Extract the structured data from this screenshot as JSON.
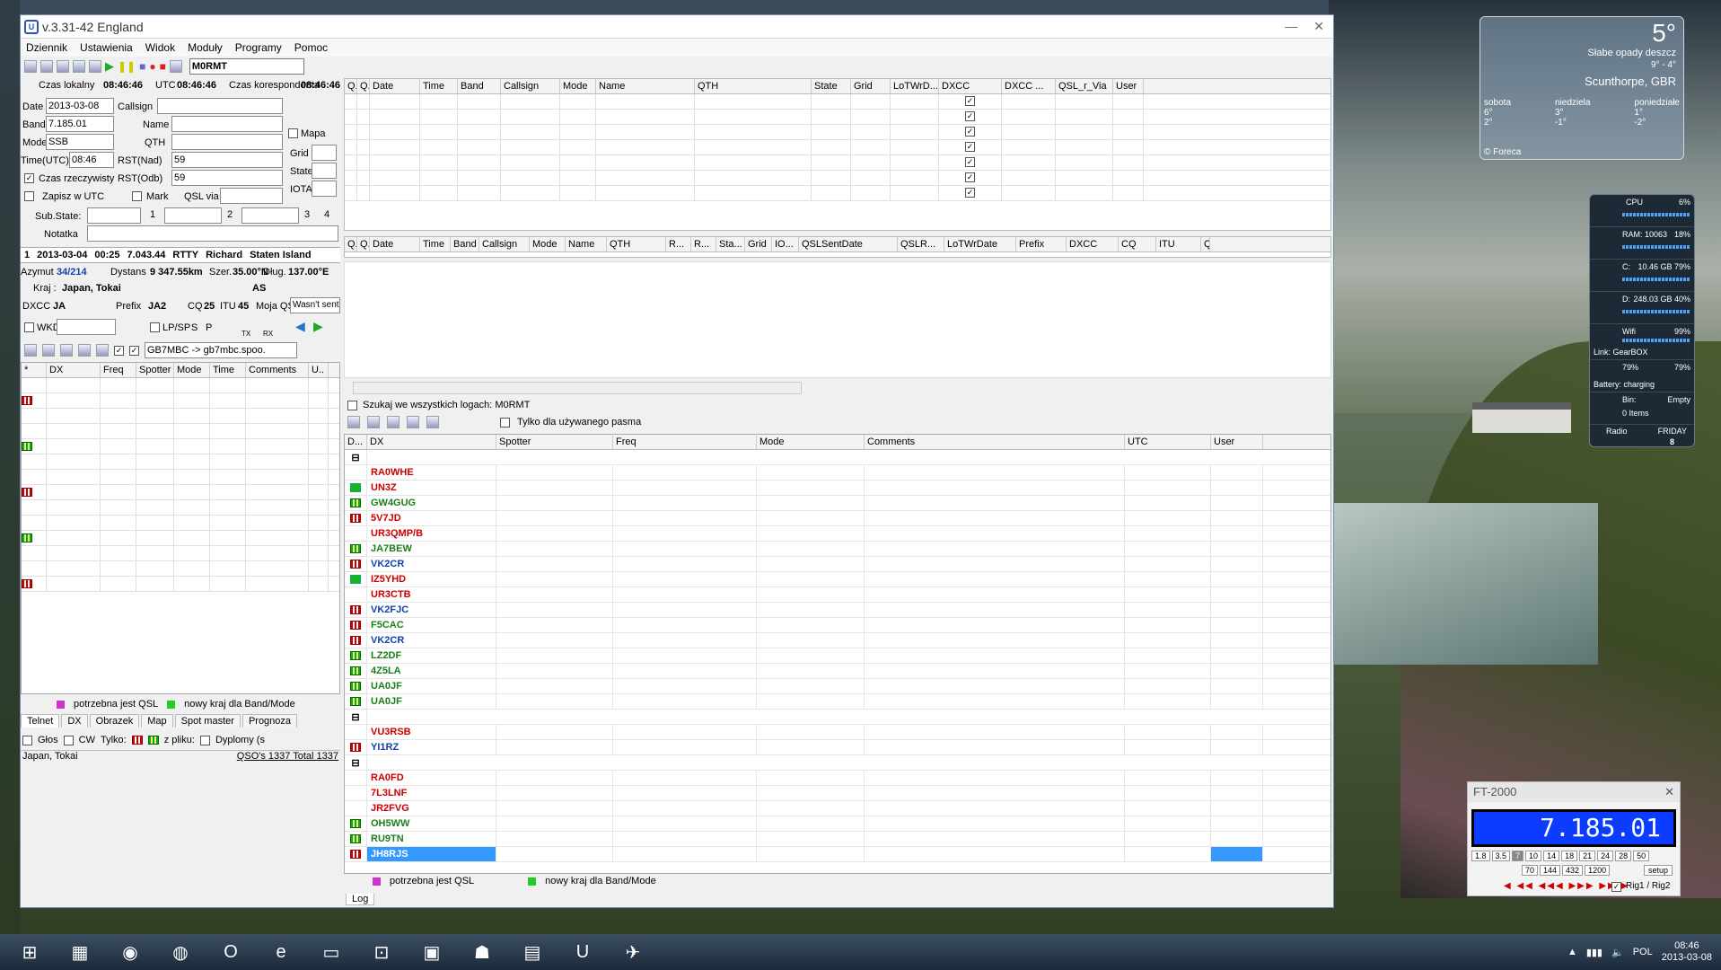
{
  "app": {
    "title": "v.3.31-42 England",
    "icon": "U"
  },
  "menu": [
    "Dziennik",
    "Ustawienia",
    "Widok",
    "Moduły",
    "Programy",
    "Pomoc"
  ],
  "toolbar": {
    "callsign": "M0RMT"
  },
  "clock": {
    "local_label": "Czas lokalny",
    "local": "08:46:46",
    "utc_label": "UTC",
    "utc": "08:46:46",
    "corr_label": "Czas korespondenta",
    "corr": "08:46:46"
  },
  "qso": {
    "date_label": "Date",
    "date": "2013-03-08",
    "band_label": "Band",
    "band": "7.185.01",
    "mode_label": "Mode",
    "mode": "SSB",
    "time_label": "Time(UTC)",
    "time": "08:46",
    "callsign_label": "Callsign",
    "name_label": "Name",
    "qth_label": "QTH",
    "rst_s_label": "RST(Nad)",
    "rst_s": "59",
    "rst_r_label": "RST(Odb)",
    "rst_r": "59",
    "realtime_label": "Czas rzeczywisty",
    "save_utc_label": "Zapisz w UTC",
    "mark_label": "Mark",
    "qslvia_label": "QSL via",
    "map_label": "Mapa",
    "grid_label": "Grid",
    "state_label": "State",
    "iota_label": "IOTA",
    "substate_label": "Sub.State:",
    "note_label": "Notatka",
    "n1": "1",
    "n2": "2",
    "n3": "3",
    "n4": "4",
    "m": "M"
  },
  "lastqso": {
    "num": "1",
    "date": "2013-03-04",
    "time": "00:25",
    "freq": "7.043.44",
    "mode": "RTTY",
    "name": "Richard",
    "qth": "Staten Island"
  },
  "info": {
    "azimuth_label": "Azymut",
    "azimuth": "34/214",
    "distance_label": "Dystans",
    "distance": "9 347.55km",
    "lat_label": "Szer.",
    "lat": "35.00°N",
    "lon_label": "Dług.",
    "lon": "137.00°E",
    "country_label": "Kraj :",
    "country": "Japan, Tokai",
    "continent": "AS",
    "dxcc_label": "DXCC",
    "dxcc": "JA",
    "prefix_label": "Prefix",
    "prefix": "JA2",
    "cq_label": "CQ",
    "cq": "25",
    "itu_label": "ITU",
    "itu": "45",
    "myqsl_label": "Moja QSL",
    "myqsl": "Wasn't sent"
  },
  "wkd": {
    "wkd_label": "WKD",
    "lpsp_label": "LP/SP",
    "s": "S",
    "p": "P",
    "tx": "TX",
    "rx": "RX"
  },
  "cluster": {
    "server": "GB7MBC -> gb7mbc.spoo.",
    "columns": [
      "*",
      "DX",
      "Freq",
      "Spotter",
      "Mode",
      "Time",
      "Comments",
      "U.."
    ]
  },
  "legend": {
    "need_qsl": "potrzebna jest QSL",
    "new_country": "nowy kraj dla Band/Mode"
  },
  "left_tabs": [
    "Telnet",
    "DX",
    "Obrazek",
    "Map",
    "Spot master",
    "Prognoza"
  ],
  "filters": {
    "glos": "Głos",
    "cw": "CW",
    "only": "Tylko:",
    "fromfile": "z pliku:",
    "diplomas": "Dyplomy (s"
  },
  "status": {
    "location": "Japan, Tokai",
    "total": "QSO's 1337 Total 1337"
  },
  "log_top": {
    "columns": [
      "Q.",
      "Q.",
      "Date",
      "Time",
      "Band",
      "Callsign",
      "Mode",
      "Name",
      "QTH",
      "State",
      "Grid",
      "LoTWrD...",
      "DXCC",
      "DXCC ...",
      "QSL_r_Via",
      "User"
    ]
  },
  "log_bottom": {
    "columns": [
      "Q.",
      "Q.",
      "Date",
      "Time",
      "Band",
      "Callsign",
      "Mode",
      "Name",
      "QTH",
      "R...",
      "R...",
      "Sta...",
      "Grid",
      "IO...",
      "QSLSentDate",
      "QSLR...",
      "LoTWrDate",
      "Prefix",
      "DXCC",
      "CQ",
      "ITU",
      "Q"
    ]
  },
  "search": {
    "all_logs": "Szukaj we wszystkich logach: M0RMT",
    "band_only": "Tylko dla używanego pasma"
  },
  "dxgrid": {
    "columns": [
      "D...",
      "DX",
      "Spotter",
      "Freq",
      "Mode",
      "Comments",
      "UTC",
      "User"
    ],
    "group1": [
      {
        "call": "RA0WHE",
        "c": "red",
        "f": ""
      },
      {
        "call": "UN3Z",
        "c": "red",
        "f": "g"
      },
      {
        "call": "GW4GUG",
        "c": "green",
        "f": "gc"
      },
      {
        "call": "5V7JD",
        "c": "red",
        "f": "r"
      },
      {
        "call": "UR3QMP/B",
        "c": "red",
        "f": ""
      },
      {
        "call": "JA7BEW",
        "c": "green",
        "f": "gc"
      },
      {
        "call": "VK2CR",
        "c": "blue",
        "f": "r"
      },
      {
        "call": "IZ5YHD",
        "c": "red",
        "f": "g"
      },
      {
        "call": "UR3CTB",
        "c": "red",
        "f": ""
      },
      {
        "call": "VK2FJC",
        "c": "blue",
        "f": "r"
      },
      {
        "call": "F5CAC",
        "c": "green",
        "f": "r"
      },
      {
        "call": "VK2CR",
        "c": "blue",
        "f": "r"
      },
      {
        "call": "LZ2DF",
        "c": "green",
        "f": "gc"
      },
      {
        "call": "4Z5LA",
        "c": "green",
        "f": "gc"
      },
      {
        "call": "UA0JF",
        "c": "green",
        "f": "gc"
      },
      {
        "call": "UA0JF",
        "c": "green",
        "f": "gc"
      }
    ],
    "group2": [
      {
        "call": "VU3RSB",
        "c": "red",
        "f": ""
      },
      {
        "call": "YI1RZ",
        "c": "blue",
        "f": "r"
      }
    ],
    "group3": [
      {
        "call": "RA0FD",
        "c": "red",
        "f": ""
      },
      {
        "call": "7L3LNF",
        "c": "red",
        "f": ""
      },
      {
        "call": "JR2FVG",
        "c": "red",
        "f": ""
      },
      {
        "call": "OH5WW",
        "c": "green",
        "f": "gc"
      },
      {
        "call": "RU9TN",
        "c": "green",
        "f": "gc"
      },
      {
        "call": "JH8RJS",
        "c": "white",
        "f": "r"
      }
    ]
  },
  "bottom_tab": "Log",
  "weather": {
    "temp": "5°",
    "desc": "Słabe opady deszcz",
    "range": "9° - 4°",
    "city": "Scunthorpe, GBR",
    "days": [
      {
        "name": "sobota",
        "hi": "6°",
        "lo": "2°"
      },
      {
        "name": "niedziela",
        "hi": "3°",
        "lo": "-1°"
      },
      {
        "name": "poniedziałe",
        "hi": "1°",
        "lo": "-2°"
      }
    ],
    "source": "© Foreca"
  },
  "meter": {
    "cpu_label": "CPU",
    "cpu": "6%",
    "ram_label": "RAM: 10063",
    "ram": "18%",
    "c_label": "C:",
    "c": "10.46 GB 79%",
    "d_label": "D:",
    "d": "248.03 GB 40%",
    "wifi_label": "Wifi",
    "wifi": "99%",
    "link": "Link: GearBOX",
    "bat1": "79%",
    "bat2": "79%",
    "bat_status": "Battery: charging",
    "bin_label": "Bin:",
    "bin_state": "Empty",
    "bin_items": "0 Items",
    "radio": "Radio",
    "day": "FRIDAY",
    "daynum": "8"
  },
  "ft2000": {
    "title": "FT-2000",
    "freq": "7.185.01",
    "bands1": [
      "1.8",
      "3.5",
      "7",
      "10",
      "14",
      "18",
      "21",
      "24",
      "28",
      "50"
    ],
    "bands2": [
      "70",
      "144",
      "432",
      "1200"
    ],
    "setup": "setup",
    "rig": "Rig1 / Rig2"
  },
  "tray": {
    "lang": "POL",
    "time": "08:46",
    "date": "2013-03-08"
  },
  "taskbar_icons": [
    "start-icon",
    "calculator-icon",
    "chrome-icon",
    "firefox-icon",
    "opera-icon",
    "ie-icon",
    "folder-icon",
    "network-icon",
    "app1-icon",
    "app2-icon",
    "app3-icon",
    "ucx-icon",
    "app4-icon"
  ],
  "colors": {
    "selection": "#3399ff",
    "lcd": "#0c3cff",
    "red": "#cc0000",
    "green": "#1a7f1a",
    "blue": "#1240b0"
  }
}
